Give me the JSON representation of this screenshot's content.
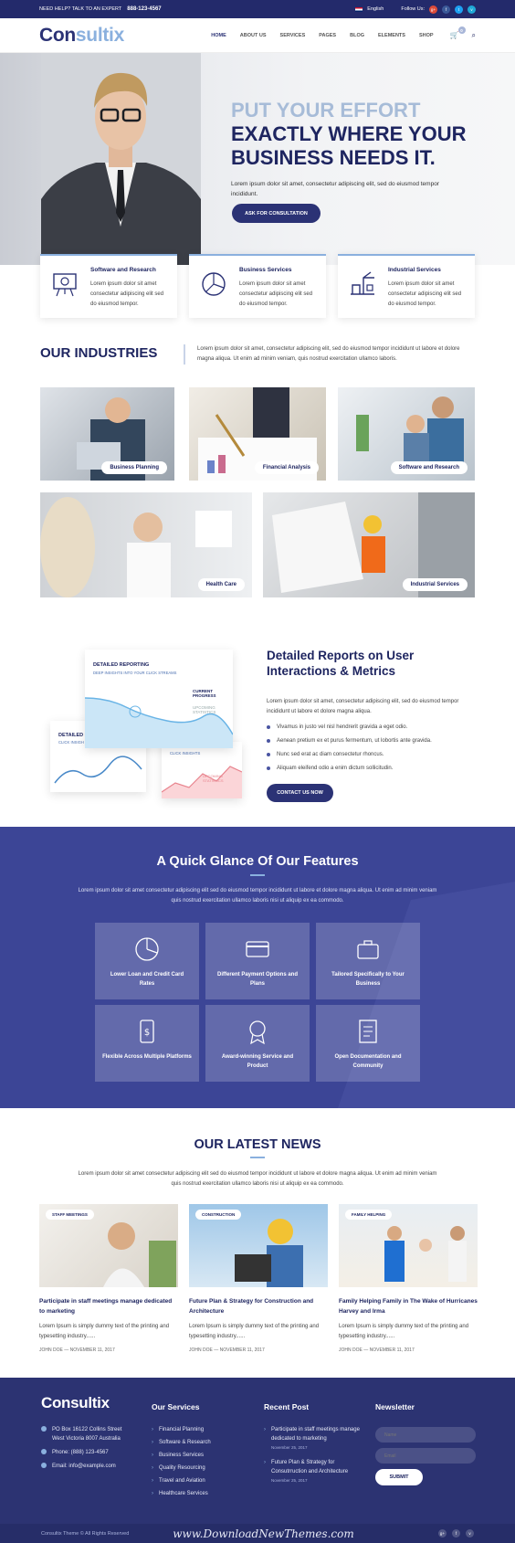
{
  "topbar": {
    "help": "NEED HELP? TALK TO AN EXPERT",
    "phone": "888-123-4567",
    "language": "English",
    "follow": "Follow Us:"
  },
  "nav": {
    "logo_a": "Con",
    "logo_b": "sultix",
    "items": [
      "HOME",
      "ABOUT US",
      "SERVICES",
      "PAGES",
      "BLOG",
      "ELEMENTS",
      "SHOP"
    ],
    "cart_count": "0"
  },
  "hero": {
    "line1": "PUT YOUR EFFORT",
    "line2": "EXACTLY WHERE YOUR",
    "line3": "BUSINESS NEEDS IT.",
    "text": "Lorem ipsum dolor sit amet, consectetur adipiscing elit, sed do eiusmod tempor incididunt.",
    "button": "ASK FOR CONSULTATION"
  },
  "features": [
    {
      "title": "Software and Research",
      "text": "Lorem ipsum dolor sit amet consectetur adipiscing elit sed do eiusmod tempor."
    },
    {
      "title": "Business Services",
      "text": "Lorem ipsum dolor sit amet consectetur adipiscing elit sed do eiusmod tempor."
    },
    {
      "title": "Industrial Services",
      "text": "Lorem ipsum dolor sit amet consectetur adipiscing elit sed do eiusmod tempor."
    }
  ],
  "industries": {
    "title": "OUR INDUSTRIES",
    "text": "Lorem ipsum dolor sit amet, consectetur adipiscing elit, sed do eiusmod tempor incididunt ut labore et dolore magna aliqua. Ut enim ad minim veniam, quis nostrud exercitation ullamco laboris.",
    "tiles": [
      "Business Planning",
      "Financial Analysis",
      "Software and Research",
      "Health Care",
      "Industrial Services"
    ]
  },
  "reports": {
    "title": "Detailed Reports on User Interactions & Metrics",
    "text": "Lorem ipsum dolor sit amet, consectetur adipiscing elit, sed do eiusmod tempor incididunt ut labore et dolore magna aliqua.",
    "checks": [
      "Vivamus in justo vel nisl hendrerit gravida a eget odio.",
      "Aenean pretium ex et purus fermentum, ut lobortis ante gravida.",
      "Nunc sed erat ac diam consectetur rhoncus.",
      "Aliquam eleifend odio a enim dictum sollicitudin."
    ],
    "button": "CONTACT US NOW",
    "card_main_title": "DETAILED REPORTING",
    "card_main_sub": "DEEP INSIGHTS INTO YOUR CLICK STREAMS",
    "legend_current": "CURRENT PROGRESS",
    "legend_upcoming": "UPCOMING STATISTICS",
    "card_left_title": "DETAILED R",
    "card_left_sub": "CLICK INSIGH",
    "card_right_sub": "CLICK INSIGHTS",
    "legend_upcoming2": "UPCOMING STATISTICS"
  },
  "glance": {
    "title": "A Quick Glance Of Our Features",
    "text": "Lorem ipsum dolor sit amet consectetur adipiscing elit sed do eiusmod tempor incididunt ut labore et dolore magna aliqua. Ut enim ad minim veniam quis nostrud exercitation ullamco laboris nisi ut aliquip ex ea commodo.",
    "boxes": [
      "Lower Loan and Credit Card Rates",
      "Different Payment Options and Plans",
      "Tailored Specifically to Your Business",
      "Flexible Across Multiple Platforms",
      "Award-winning Service and Product",
      "Open Documentation and Community"
    ]
  },
  "news": {
    "title": "OUR LATEST NEWS",
    "text": "Lorem ipsum dolor sit amet consectetur adipiscing elit sed do eiusmod tempor incididunt ut labore et dolore magna aliqua. Ut enim ad minim veniam quis nostrud exercitation ullamco laboris nisi ut aliquip ex ea commodo.",
    "posts": [
      {
        "tag": "STAFF MEETINGS",
        "title": "Participate in staff meetings manage dedicated to marketing",
        "text": "Lorem Ipsum is simply dummy text of the printing and typesetting industry......",
        "author": "JOHN DOE",
        "date": "NOVEMBER 11, 2017"
      },
      {
        "tag": "CONSTRUCTION",
        "title": "Future Plan & Strategy for Construction and Architecture",
        "text": "Lorem Ipsum is simply dummy text of the printing and typesetting industry......",
        "author": "JOHN DOE",
        "date": "NOVEMBER 11, 2017"
      },
      {
        "tag": "FAMILY HELPING",
        "title": "Family Helping Family in The Wake of Hurricanes Harvey and Irma",
        "text": "Lorem Ipsum is simply dummy text of the printing and typesetting industry......",
        "author": "JOHN DOE",
        "date": "NOVEMBER 11, 2017"
      }
    ]
  },
  "footer": {
    "logo": "Consultix",
    "address": "PO Box 16122 Collins Street West Victoria 8007 Australia",
    "phone": "Phone: (888) 123-4567",
    "email": "Email: info@example.com",
    "services_title": "Our Services",
    "services": [
      "Financial Planning",
      "Software & Research",
      "Business Services",
      "Quality Resourcing",
      "Travel and Aviation",
      "Healthcare Services"
    ],
    "recent_title": "Recent Post",
    "recent": [
      {
        "title": "Participate in staff meetings manage dedicated to marketing",
        "date": "November 25, 2017"
      },
      {
        "title": "Future Plan & Strategy for Consutrruction and Architecture",
        "date": "November 25, 2017"
      }
    ],
    "newsletter_title": "Newsletter",
    "name_placeholder": "Name",
    "email_placeholder": "Email",
    "submit": "SUBMIT",
    "copyright": "Consultix Theme © All Rights Reserved",
    "watermark": "www.DownloadNewThemes.com"
  }
}
